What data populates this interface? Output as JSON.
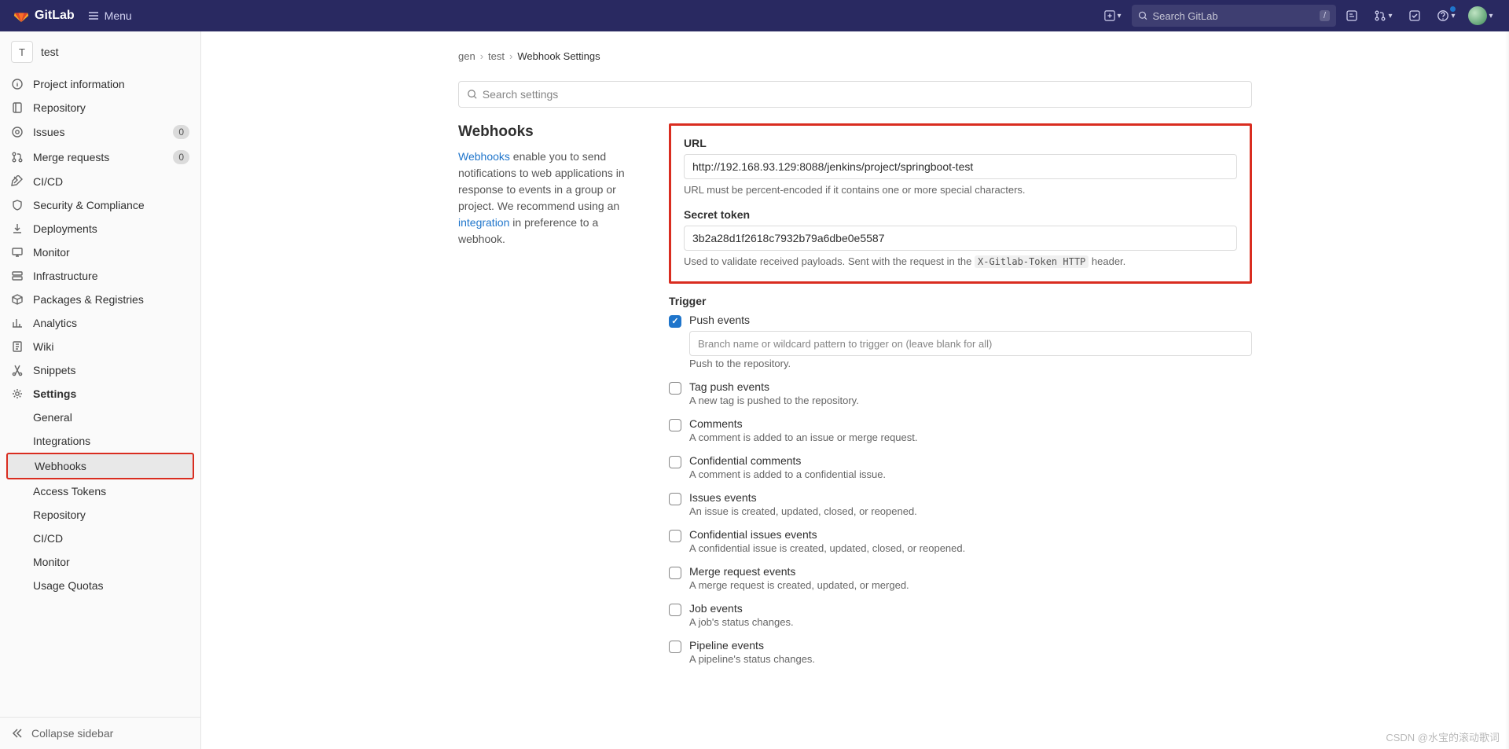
{
  "header": {
    "brand": "GitLab",
    "menu_label": "Menu",
    "search_placeholder": "Search GitLab",
    "slash_key": "/"
  },
  "sidebar": {
    "project_avatar": "T",
    "project_name": "test",
    "items": [
      {
        "icon": "info",
        "label": "Project information"
      },
      {
        "icon": "repo",
        "label": "Repository"
      },
      {
        "icon": "issues",
        "label": "Issues",
        "count": "0"
      },
      {
        "icon": "mr",
        "label": "Merge requests",
        "count": "0"
      },
      {
        "icon": "cicd",
        "label": "CI/CD"
      },
      {
        "icon": "shield",
        "label": "Security & Compliance"
      },
      {
        "icon": "deploy",
        "label": "Deployments"
      },
      {
        "icon": "monitor",
        "label": "Monitor"
      },
      {
        "icon": "infra",
        "label": "Infrastructure"
      },
      {
        "icon": "package",
        "label": "Packages & Registries"
      },
      {
        "icon": "analytics",
        "label": "Analytics"
      },
      {
        "icon": "wiki",
        "label": "Wiki"
      },
      {
        "icon": "snippets",
        "label": "Snippets"
      },
      {
        "icon": "settings",
        "label": "Settings",
        "bold": true
      }
    ],
    "settings_sub": [
      {
        "label": "General"
      },
      {
        "label": "Integrations"
      },
      {
        "label": "Webhooks",
        "active": true
      },
      {
        "label": "Access Tokens"
      },
      {
        "label": "Repository"
      },
      {
        "label": "CI/CD"
      },
      {
        "label": "Monitor"
      },
      {
        "label": "Usage Quotas"
      }
    ],
    "collapse_label": "Collapse sidebar"
  },
  "breadcrumbs": [
    "gen",
    "test",
    "Webhook Settings"
  ],
  "settings_search_placeholder": "Search settings",
  "left_panel": {
    "title": "Webhooks",
    "link1": "Webhooks",
    "desc_part1": " enable you to send notifications to web applications in response to events in a group or project. We recommend using an ",
    "link2": "integration",
    "desc_part2": " in preference to a webhook."
  },
  "form": {
    "url_label": "URL",
    "url_value": "http://192.168.93.129:8088/jenkins/project/springboot-test",
    "url_help": "URL must be percent-encoded if it contains one or more special characters.",
    "secret_label": "Secret token",
    "secret_value": "3b2a28d1f2618c7932b79a6dbe0e5587",
    "secret_help_pre": "Used to validate received payloads. Sent with the request in the ",
    "secret_help_code": "X-Gitlab-Token HTTP",
    "secret_help_post": " header.",
    "trigger_label": "Trigger",
    "triggers": {
      "push": {
        "label": "Push events",
        "checked": true,
        "placeholder": "Branch name or wildcard pattern to trigger on (leave blank for all)",
        "desc": "Push to the repository."
      },
      "tag": {
        "label": "Tag push events",
        "desc": "A new tag is pushed to the repository."
      },
      "comments": {
        "label": "Comments",
        "desc": "A comment is added to an issue or merge request."
      },
      "conf_comments": {
        "label": "Confidential comments",
        "desc": "A comment is added to a confidential issue."
      },
      "issues": {
        "label": "Issues events",
        "desc": "An issue is created, updated, closed, or reopened."
      },
      "conf_issues": {
        "label": "Confidential issues events",
        "desc": "A confidential issue is created, updated, closed, or reopened."
      },
      "mr": {
        "label": "Merge request events",
        "desc": "A merge request is created, updated, or merged."
      },
      "job": {
        "label": "Job events",
        "desc": "A job's status changes."
      },
      "pipeline": {
        "label": "Pipeline events",
        "desc": "A pipeline's status changes."
      }
    }
  },
  "watermark": "CSDN @水宝的滚动歌词"
}
